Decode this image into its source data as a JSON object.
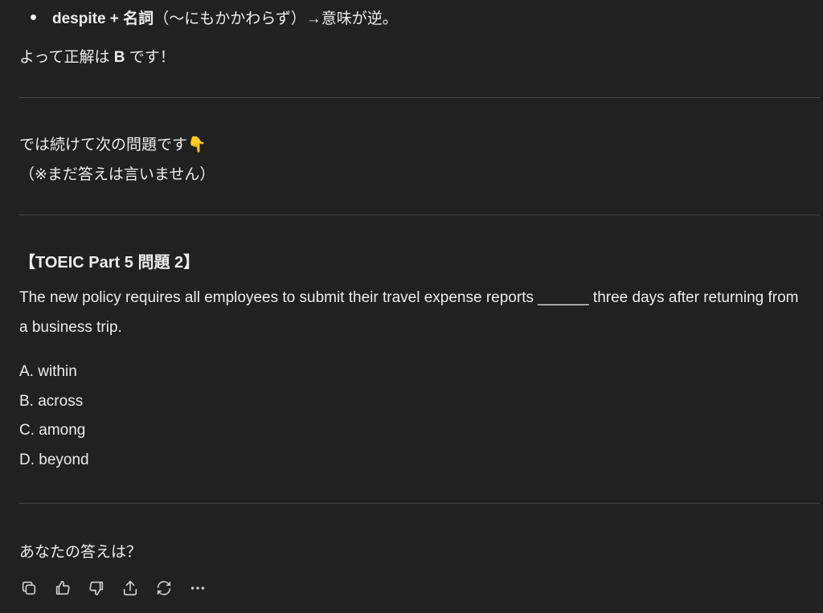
{
  "message": {
    "bullet": {
      "term": "despite + 名詞",
      "explanation": "（〜にもかかわらず）→意味が逆。"
    },
    "answer_prefix": "よって正解は ",
    "answer_letter": "B",
    "answer_suffix": " です！",
    "continue_line": "では続けて次の問題です👇",
    "note_line": "（※まだ答えは言いません）",
    "question_title": "【TOEIC Part 5 問題 2】",
    "question_text": "The new policy requires all employees to submit their travel expense reports ______ three days after returning from a business trip.",
    "options": [
      "A. within",
      "B. across",
      "C. among",
      "D. beyond"
    ],
    "prompt": "あなたの答えは？"
  },
  "toolbar": {
    "icons": [
      "copy-icon",
      "thumbs-up-icon",
      "thumbs-down-icon",
      "share-icon",
      "regenerate-icon",
      "more-icon"
    ]
  },
  "colors": {
    "background": "#212121",
    "text": "#ececec",
    "divider": "#454545"
  }
}
